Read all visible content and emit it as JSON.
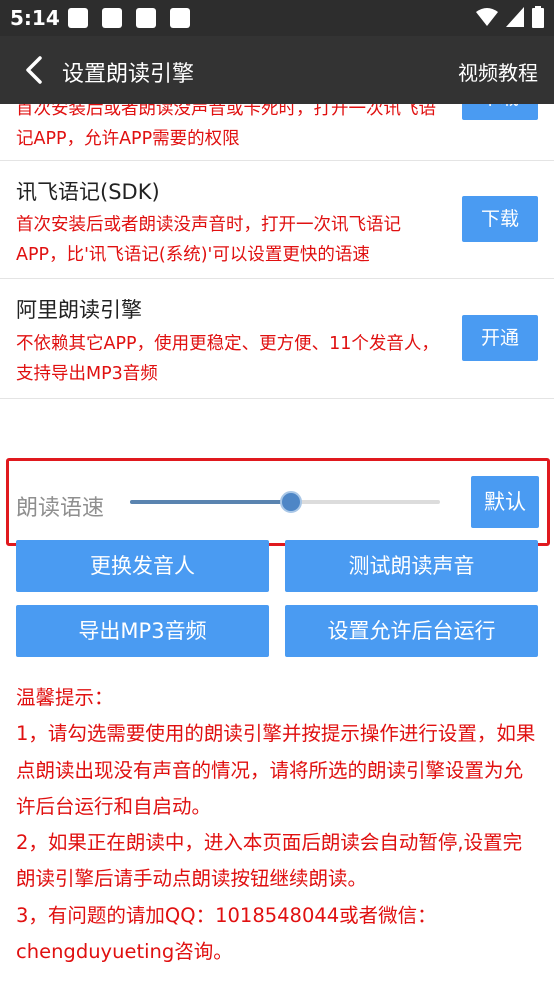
{
  "status_bar": {
    "time": "5:14"
  },
  "app_bar": {
    "title": "设置朗读引擎",
    "right_link": "视频教程"
  },
  "engines": [
    {
      "name": "",
      "desc": "首次安装后或者朗读没声音或卡死时，打开一次讯飞语记APP，允许APP需要的权限",
      "button": "下载"
    },
    {
      "name": "讯飞语记(SDK)",
      "desc": "首次安装后或者朗读没声音时，打开一次讯飞语记APP，比'讯飞语记(系统)'可以设置更快的语速",
      "button": "下载"
    },
    {
      "name": "阿里朗读引擎",
      "desc": "不依赖其它APP，使用更稳定、更方便、11个发音人，支持导出MP3音频",
      "button": "开通"
    }
  ],
  "speed": {
    "label": "朗读语速",
    "value_fraction": 0.52,
    "default_button": "默认"
  },
  "actions": {
    "change_voice": "更换发音人",
    "test_voice": "测试朗读声音",
    "export_mp3": "导出MP3音频",
    "allow_background": "设置允许后台运行"
  },
  "tips": {
    "title": "温馨提示：",
    "items": [
      "1，请勾选需要使用的朗读引擎并按提示操作进行设置，如果点朗读出现没有声音的情况，请将所选的朗读引擎设置为允许后台运行和自启动。",
      "2，如果正在朗读中，进入本页面后朗读会自动暂停,设置完朗读引擎后请手动点朗读按钮继续朗读。",
      "3，有问题的请加QQ：1018548044或者微信：chengduyueting咨询。"
    ]
  },
  "colors": {
    "accent": "#4a9bf2",
    "warning_text": "#e01010",
    "appbar": "#333333"
  }
}
